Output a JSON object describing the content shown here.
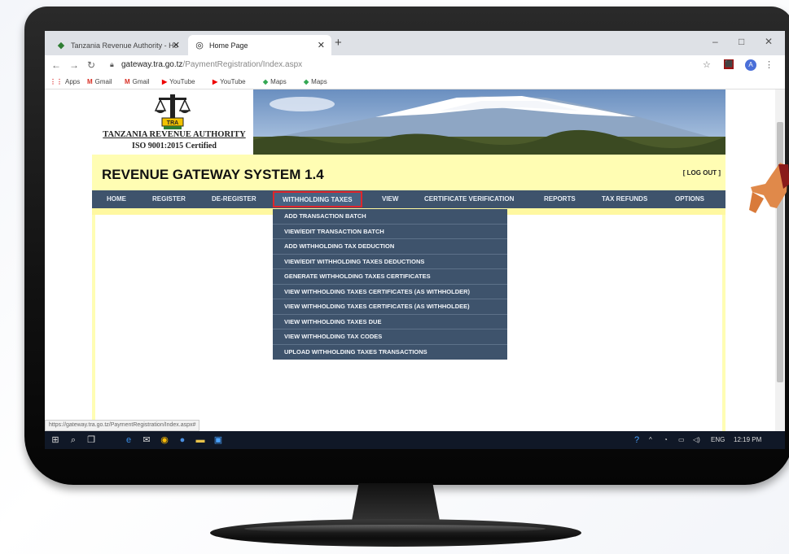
{
  "browser": {
    "tabs": [
      {
        "label": "Tanzania Revenue Authority - Ho",
        "icon": "tra-flag-icon"
      },
      {
        "label": "Home Page",
        "icon": "globe-icon"
      }
    ],
    "new_tab_symbol": "+",
    "window_controls": [
      "–",
      "□",
      "✕"
    ],
    "url_host": "gateway.tra.go.tz",
    "url_path": "/PaymentRegistration/Index.aspx",
    "bookmarks": [
      "Apps",
      "Gmail",
      "Gmail",
      "YouTube",
      "YouTube",
      "Maps",
      "Maps"
    ],
    "profile_initial": "A",
    "status_url": "https://gateway.tra.go.tz/PaymentRegistration/Index.aspx#"
  },
  "page": {
    "org_name": "TANZANIA REVENUE AUTHORITY",
    "iso": "ISO 9001:2015 Certified",
    "logo_text": "TRA",
    "title": "REVENUE GATEWAY SYSTEM 1.4",
    "logout": "[ LOG OUT ]",
    "nav": [
      "HOME",
      "REGISTER",
      "DE-REGISTER",
      "WITHHOLDING TAXES",
      "VIEW",
      "CERTIFICATE VERIFICATION",
      "REPORTS",
      "TAX REFUNDS",
      "OPTIONS"
    ],
    "active_nav": "WITHHOLDING TAXES",
    "dropdown": [
      "ADD TRANSACTION BATCH",
      "VIEW/EDIT TRANSACTION BATCH",
      "ADD WITHHOLDING TAX DEDUCTION",
      "VIEW/EDIT WITHHOLDING TAXES DEDUCTIONS",
      "GENERATE WITHHOLDING TAXES CERTIFICATES",
      "VIEW WITHHOLDING TAXES CERTIFICATES (AS WITHHOLDER)",
      "VIEW WITHHOLDING TAXES CERTIFICATES (AS WITHHOLDEE)",
      "VIEW WITHHOLDING TAXES DUE",
      "VIEW WITHHOLDING TAX CODES",
      "UPLOAD WITHHOLDING TAXES TRANSACTIONS"
    ]
  },
  "taskbar": {
    "tray_language": "ENG",
    "time": "12:19 PM"
  },
  "colors": {
    "nav_bg": "#3e536c",
    "page_bg": "#fffdb3",
    "active_border": "#e0262b"
  }
}
